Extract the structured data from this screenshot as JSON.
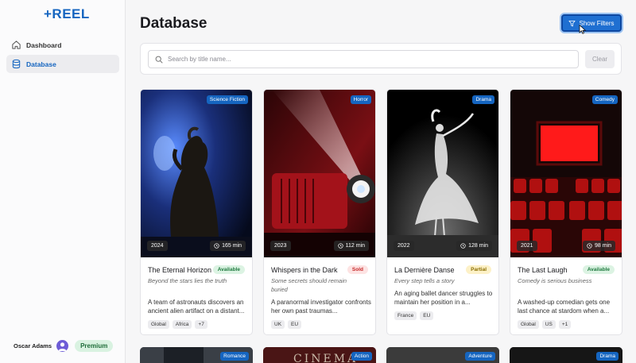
{
  "app": {
    "logo": "+REEL"
  },
  "sidebar": {
    "items": [
      {
        "label": "Dashboard",
        "icon": "home-icon"
      },
      {
        "label": "Database",
        "icon": "database-icon",
        "active": true
      }
    ],
    "user": {
      "name": "Oscar Adams",
      "plan": "Premium"
    }
  },
  "header": {
    "title": "Database",
    "filters_label": "Show Filters"
  },
  "search": {
    "placeholder": "Search by title name...",
    "value": "",
    "clear_label": "Clear"
  },
  "colors": {
    "accent": "#1565c0",
    "available": "#1f7a3f",
    "sold": "#c62828",
    "partial": "#8a6d00"
  },
  "movies": [
    {
      "genre": "Science Fiction",
      "year": "2024",
      "runtime": "165 min",
      "title": "The Eternal Horizon",
      "status": "Available",
      "tagline": "Beyond the stars lies the truth",
      "description": "A team of astronauts discovers an ancient alien artifact on a distant...",
      "tags": [
        "Global",
        "Africa",
        "+7"
      ]
    },
    {
      "genre": "Horror",
      "year": "2023",
      "runtime": "112 min",
      "title": "Whispers in the Dark",
      "status": "Sold",
      "tagline": "Some secrets should remain buried",
      "description": "A paranormal investigator confronts her own past traumas...",
      "tags": [
        "UK",
        "EU"
      ]
    },
    {
      "genre": "Drama",
      "year": "2022",
      "runtime": "128 min",
      "title": "La Dernière Danse",
      "status": "Partial",
      "tagline": "Every step tells a story",
      "description": "An aging ballet dancer struggles to maintain her position in a...",
      "tags": [
        "France",
        "EU"
      ]
    },
    {
      "genre": "Comedy",
      "year": "2021",
      "runtime": "98 min",
      "title": "The Last Laugh",
      "status": "Available",
      "tagline": "Comedy is serious business",
      "description": "A washed-up comedian gets one last chance at stardom when a...",
      "tags": [
        "Global",
        "US",
        "+1"
      ]
    }
  ],
  "next_row": [
    {
      "genre": "Romance"
    },
    {
      "genre": "Action",
      "poster_text": "CINEMA"
    },
    {
      "genre": "Adventure"
    },
    {
      "genre": "Drama"
    }
  ]
}
